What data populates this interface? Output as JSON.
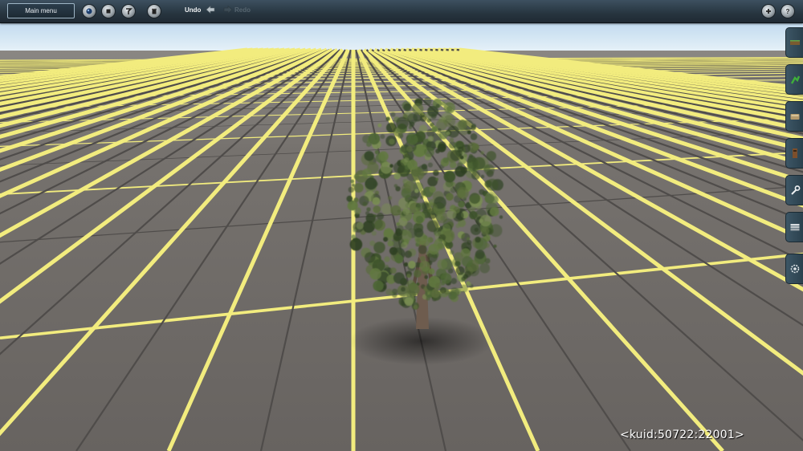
{
  "toolbar": {
    "main_menu_label": "Main menu",
    "undo_label": "Undo",
    "redo_label": "Redo"
  },
  "icons": {
    "left": [
      "camera-icon",
      "stop-icon",
      "help-pointer-icon",
      "trash-icon",
      "undo-arrow-icon",
      "redo-arrow-icon"
    ],
    "right": [
      "add-icon",
      "help-icon"
    ],
    "side_tabs": [
      "track-tab-icon",
      "objects-tab-icon",
      "terrain-tab-icon",
      "layers-tab-icon",
      "tools-tab-icon",
      "paint-tab-icon",
      "settings-tab-icon"
    ]
  },
  "scene": {
    "sky_color": "#d4e6f5",
    "ground_color": "#6f6b67",
    "grid_major_color": "#f2ec7e",
    "grid_minor_color": "#4f4c4a"
  },
  "status": {
    "asset_kuid": "<kuid:50722:22001>"
  }
}
